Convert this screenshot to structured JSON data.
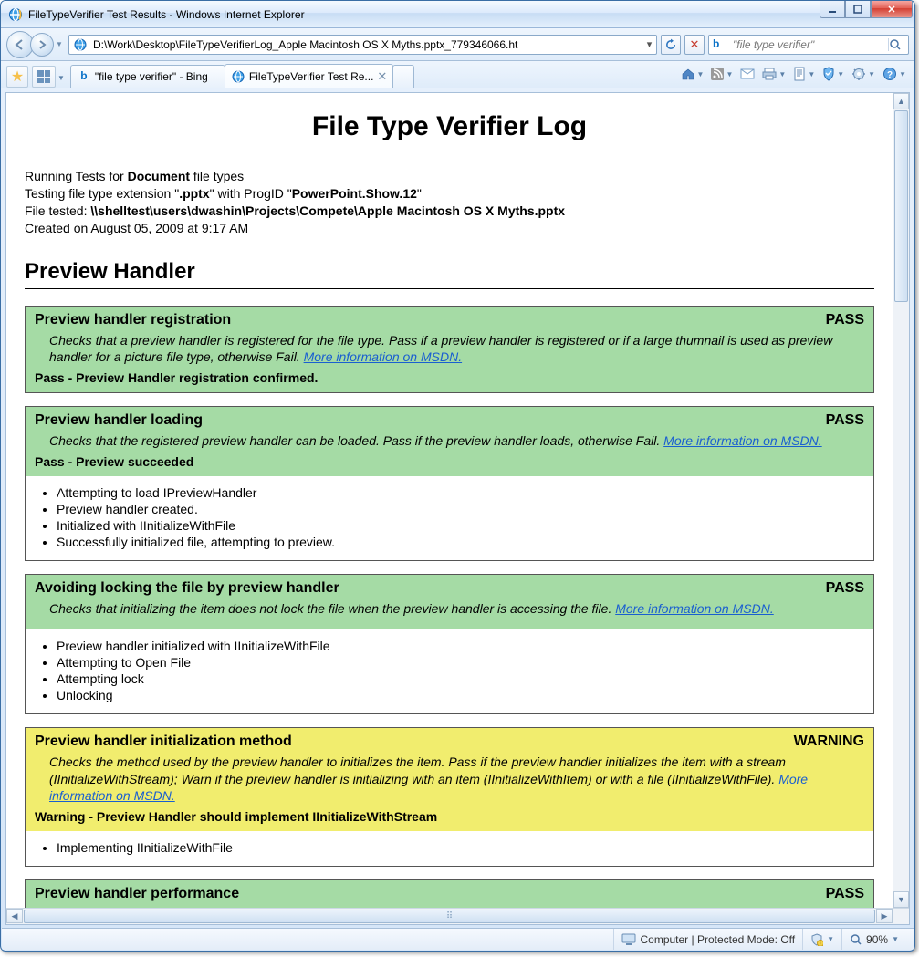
{
  "window": {
    "title": "FileTypeVerifier Test Results - Windows Internet Explorer"
  },
  "address": {
    "url": "D:\\Work\\Desktop\\FileTypeVerifierLog_Apple Macintosh OS X Myths.pptx_779346066.ht"
  },
  "search": {
    "placeholder": "\"file type verifier\""
  },
  "tabs": [
    {
      "label": "\"file type verifier\" - Bing",
      "active": false,
      "icon": "bing"
    },
    {
      "label": "FileTypeVerifier Test Re...",
      "active": true,
      "icon": "ie"
    }
  ],
  "doc": {
    "title": "File Type Verifier Log",
    "intro": {
      "line1_a": "Running Tests for ",
      "line1_b": "Document",
      "line1_c": " file types",
      "line2_a": "Testing file type extension \"",
      "line2_b": ".pptx",
      "line2_c": "\" with ProgID \"",
      "line2_d": "PowerPoint.Show.12",
      "line2_e": "\"",
      "line3_a": "File tested: ",
      "line3_b": "\\\\shelltest\\users\\dwashin\\Projects\\Compete\\Apple Macintosh OS X Myths.pptx",
      "line4": "Created on August 05, 2009 at 9:17 AM"
    },
    "section": "Preview Handler",
    "tests": [
      {
        "title": "Preview handler registration",
        "status": "PASS",
        "statusClass": "pass",
        "desc": "Checks that a preview handler is registered for the file type. Pass if a preview handler is registered or if a large thumnail is used as preview handler for a picture file type, otherwise Fail. ",
        "link": "More information on MSDN.",
        "result": "Pass - Preview Handler registration confirmed.",
        "body": []
      },
      {
        "title": "Preview handler loading",
        "status": "PASS",
        "statusClass": "pass",
        "desc": "Checks that the registered preview handler can be loaded. Pass if the preview handler loads, otherwise Fail. ",
        "link": "More information on MSDN.",
        "result": "Pass - Preview succeeded",
        "body": [
          "Attempting to load IPreviewHandler",
          "Preview handler created.",
          "Initialized with IInitializeWithFile",
          "Successfully initialized file, attempting to preview."
        ]
      },
      {
        "title": "Avoiding locking the file by preview handler",
        "status": "PASS",
        "statusClass": "pass",
        "desc": "Checks that initializing the item does not lock the file when the preview handler is accessing the file. ",
        "link": "More information on MSDN.",
        "result": "",
        "body": [
          "Preview handler initialized with IInitializeWithFile",
          "Attempting to Open File",
          "Attempting lock",
          "Unlocking"
        ]
      },
      {
        "title": "Preview handler initialization method",
        "status": "WARNING",
        "statusClass": "warn",
        "desc": "Checks the method used by the preview handler to initializes the item. Pass if the preview handler initializes the item with a stream (IInitializeWithStream); Warn if the preview handler is initializing with an item (IInitializeWithItem) or with a file (IInitializeWithFile). ",
        "link": "More information on MSDN.",
        "result": "Warning - Preview Handler should implement IInitializeWithStream",
        "body": [
          "Implementing IInitializeWithFile"
        ]
      },
      {
        "title": "Preview handler performance",
        "status": "PASS",
        "statusClass": "pass",
        "desc": "",
        "link": "",
        "result": "",
        "body": []
      }
    ]
  },
  "statusbar": {
    "zone": "Computer | Protected Mode: Off",
    "zoom": "90%"
  }
}
